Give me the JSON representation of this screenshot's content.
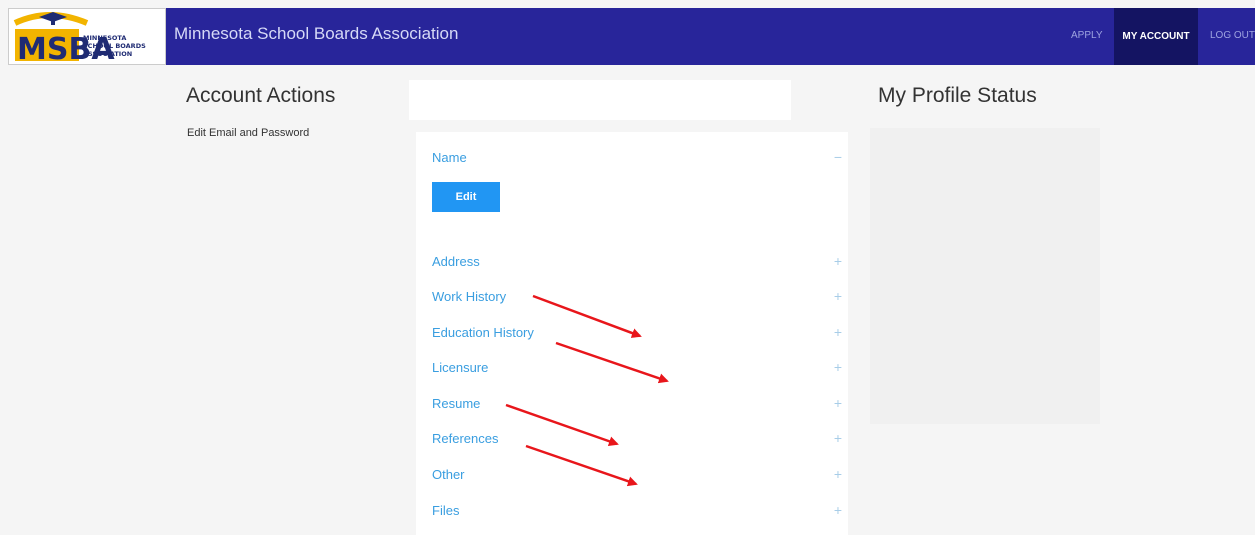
{
  "header": {
    "logo_text": "MSBA",
    "logo_subtext": "MINNESOTA SCHOOL BOARDS ASSOCIATION",
    "title": "Minnesota School Boards Association",
    "nav": {
      "apply": "APPLY",
      "my_account": "MY ACCOUNT",
      "log_out": "LOG OUT"
    }
  },
  "left": {
    "heading": "Account Actions",
    "link": "Edit Email and Password"
  },
  "panel": {
    "sections": [
      {
        "label": "Name",
        "toggle": "−"
      },
      {
        "label": "Address",
        "toggle": "+"
      },
      {
        "label": "Work History",
        "toggle": "+"
      },
      {
        "label": "Education History",
        "toggle": "+"
      },
      {
        "label": "Licensure",
        "toggle": "+"
      },
      {
        "label": "Resume",
        "toggle": "+"
      },
      {
        "label": "References",
        "toggle": "+"
      },
      {
        "label": "Other",
        "toggle": "+"
      },
      {
        "label": "Files",
        "toggle": "+"
      }
    ],
    "edit_button": "Edit"
  },
  "right": {
    "heading": "My Profile Status"
  },
  "colors": {
    "header_bg": "#28259a",
    "active_nav_bg": "#141462",
    "link_blue": "#3a9ee0",
    "button_blue": "#2196f3",
    "annotation_red": "#e8161b"
  }
}
